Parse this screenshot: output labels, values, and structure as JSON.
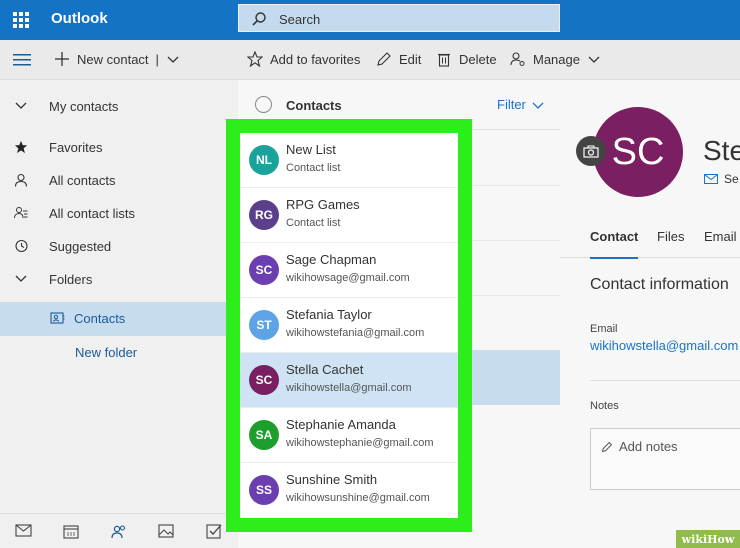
{
  "app": {
    "title": "Outlook"
  },
  "search": {
    "placeholder": "Search"
  },
  "toolbar": {
    "new_contact": "New contact",
    "add_favorites": "Add to favorites",
    "edit": "Edit",
    "delete": "Delete",
    "manage": "Manage"
  },
  "sidebar": {
    "items": [
      {
        "label": "My contacts"
      },
      {
        "label": "Favorites"
      },
      {
        "label": "All contacts"
      },
      {
        "label": "All contact lists"
      },
      {
        "label": "Suggested"
      },
      {
        "label": "Folders"
      },
      {
        "label": "Contacts"
      },
      {
        "label": "New folder"
      }
    ]
  },
  "list": {
    "header": "Contacts",
    "filter": "Filter",
    "items": [
      {
        "initials": "NL",
        "name": "New List",
        "sub": "Contact list",
        "color": "#1aa39a"
      },
      {
        "initials": "RG",
        "name": "RPG Games",
        "sub": "Contact list",
        "color": "#5b3f8c"
      },
      {
        "initials": "SC",
        "name": "Sage Chapman",
        "sub": "wikihowsage@gmail.com",
        "color": "#6b3fb0"
      },
      {
        "initials": "ST",
        "name": "Stefania Taylor",
        "sub": "wikihowstefania@gmail.com",
        "color": "#5ea3e6"
      },
      {
        "initials": "SC",
        "name": "Stella Cachet",
        "sub": "wikihowstella@gmail.com",
        "color": "#7a1f62"
      },
      {
        "initials": "SA",
        "name": "Stephanie Amanda",
        "sub": "wikihowstephanie@gmail.com",
        "color": "#1e9e2c"
      },
      {
        "initials": "SS",
        "name": "Sunshine Smith",
        "sub": "wikihowsunshine@gmail.com",
        "color": "#6b3fb0"
      }
    ]
  },
  "detail": {
    "initials": "SC",
    "name_partial": "Stel",
    "mail_partial": "Se",
    "tabs": [
      "Contact",
      "Files",
      "Email"
    ],
    "section": "Contact information",
    "email_label": "Email",
    "email_value": "wikihowstella@gmail.com",
    "notes_label": "Notes",
    "notes_placeholder": "Add notes"
  },
  "watermark": {
    "text": "wikiHow"
  },
  "colors": {
    "brand": "#1473c4",
    "highlight": "#2ded1a",
    "selected": "#c7dcee"
  }
}
